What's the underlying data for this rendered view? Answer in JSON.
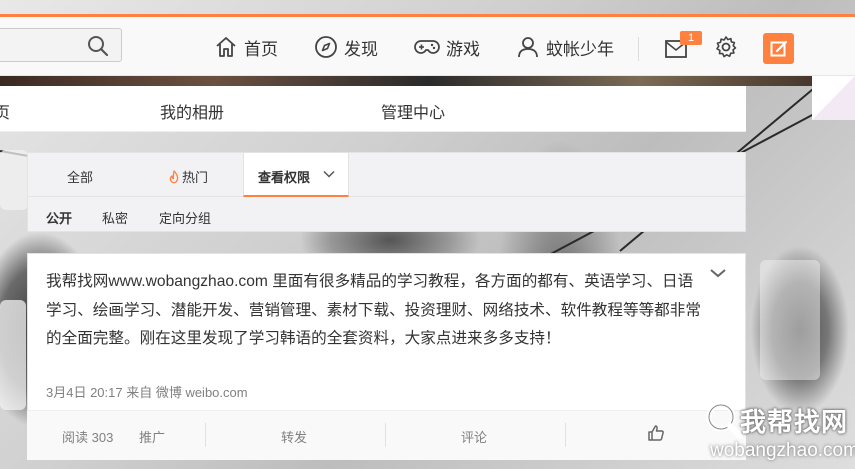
{
  "search": {
    "icon": "search-icon"
  },
  "nav": [
    {
      "label": "首页",
      "icon": "home-icon"
    },
    {
      "label": "发现",
      "icon": "compass-icon"
    },
    {
      "label": "游戏",
      "icon": "gamepad-icon"
    },
    {
      "label": "蚊帐少年",
      "icon": "user-icon"
    }
  ],
  "messages": {
    "badge": "1",
    "icon": "mail-icon"
  },
  "settings": {
    "icon": "gear-icon"
  },
  "compose": {
    "icon": "edit-icon"
  },
  "colors": {
    "accent": "#ff8140",
    "text": "#333333",
    "muted": "#808080"
  },
  "profile_tabs": {
    "home_partial": "页",
    "album": "我的相册",
    "manage": "管理中心"
  },
  "filter": {
    "all": "全部",
    "hot": "热门",
    "visibility": "查看权限",
    "sub": [
      "公开",
      "私密",
      "定向分组"
    ]
  },
  "post": {
    "text": "我帮找网www.wobangzhao.com 里面有很多精品的学习教程，各方面的都有、英语学习、日语学习、绘画学习、潜能开发、营销管理、素材下载、投资理财、网络技术、软件教程等等都非常的全面完整。刚在这里发现了学习韩语的全套资料，大家点进来多多支持！",
    "meta": "3月4日 20:17 来自 微博 weibo.com",
    "actions": {
      "reads": "阅读 303",
      "promote": "推广",
      "repost": "转发",
      "comment": "评论"
    }
  },
  "watermark": {
    "cn": "我帮找网",
    "en": "wobangzhao.com"
  }
}
